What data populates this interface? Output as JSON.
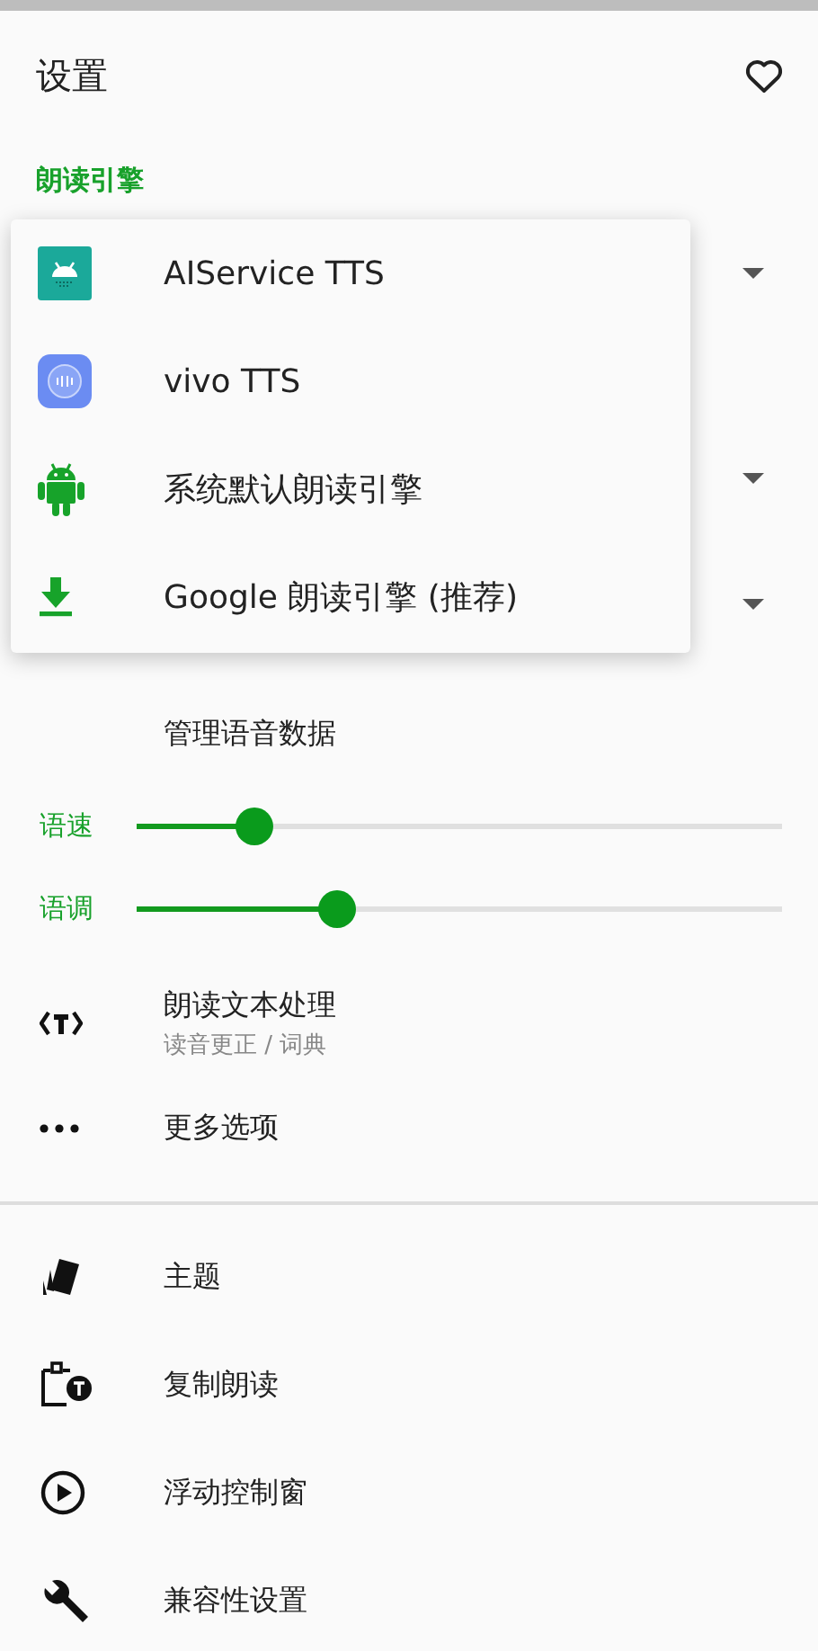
{
  "header": {
    "title": "设置"
  },
  "section_title": "朗读引擎",
  "engine_menu": {
    "items": [
      {
        "kind": "android_tile",
        "label": "AIService TTS"
      },
      {
        "kind": "vivo",
        "label": "vivo TTS"
      },
      {
        "kind": "android",
        "label": "系统默认朗读引擎"
      },
      {
        "kind": "download",
        "label": "Google 朗读引擎 (推荐)"
      }
    ]
  },
  "manage_voice_data": "管理语音数据",
  "sliders": [
    {
      "label": "语速",
      "level": 0.18
    },
    {
      "label": "语调",
      "level": 0.31
    }
  ],
  "options": [
    {
      "kind": "text_tag",
      "title": "朗读文本处理",
      "subtitle": "读音更正 / 词典"
    },
    {
      "kind": "dots",
      "title": "更多选项"
    }
  ],
  "more_settings": [
    {
      "kind": "theme",
      "title": "主题"
    },
    {
      "kind": "clipboard",
      "title": "复制朗读"
    },
    {
      "kind": "play",
      "title": "浮动控制窗"
    },
    {
      "kind": "wrench",
      "title": "兼容性设置"
    }
  ]
}
